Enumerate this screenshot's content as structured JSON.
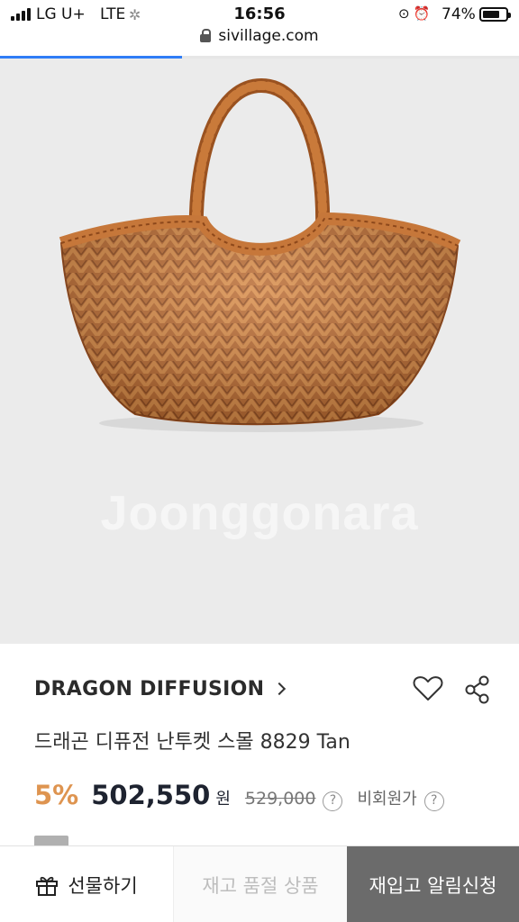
{
  "status_bar": {
    "carrier": "LG U+",
    "network": "LTE",
    "time": "16:56",
    "battery_percent": "74%",
    "battery_level": 0.74
  },
  "browser": {
    "url": "sivillage.com",
    "load_progress": 0.35,
    "accent_color": "#2f7df6"
  },
  "product": {
    "image_watermark": "Joonggonara",
    "brand": "DRAGON DIFFUSION",
    "title": "드래곤 디퓨전 난투켓 스몰 8829 Tan",
    "discount": "5%",
    "price": "502,550",
    "currency": "원",
    "original_price": "529,000",
    "member_price_label": "비회원가",
    "help_glyph": "?",
    "discount_color": "#de9450",
    "wishlist_icon": "heart-icon",
    "share_icon": "share-icon"
  },
  "bottom_bar": {
    "gift_label": "선물하기",
    "gift_icon": "gift-icon",
    "soldout_label": "재고 품절 상품",
    "restock_label": "재입고 알림신청"
  }
}
